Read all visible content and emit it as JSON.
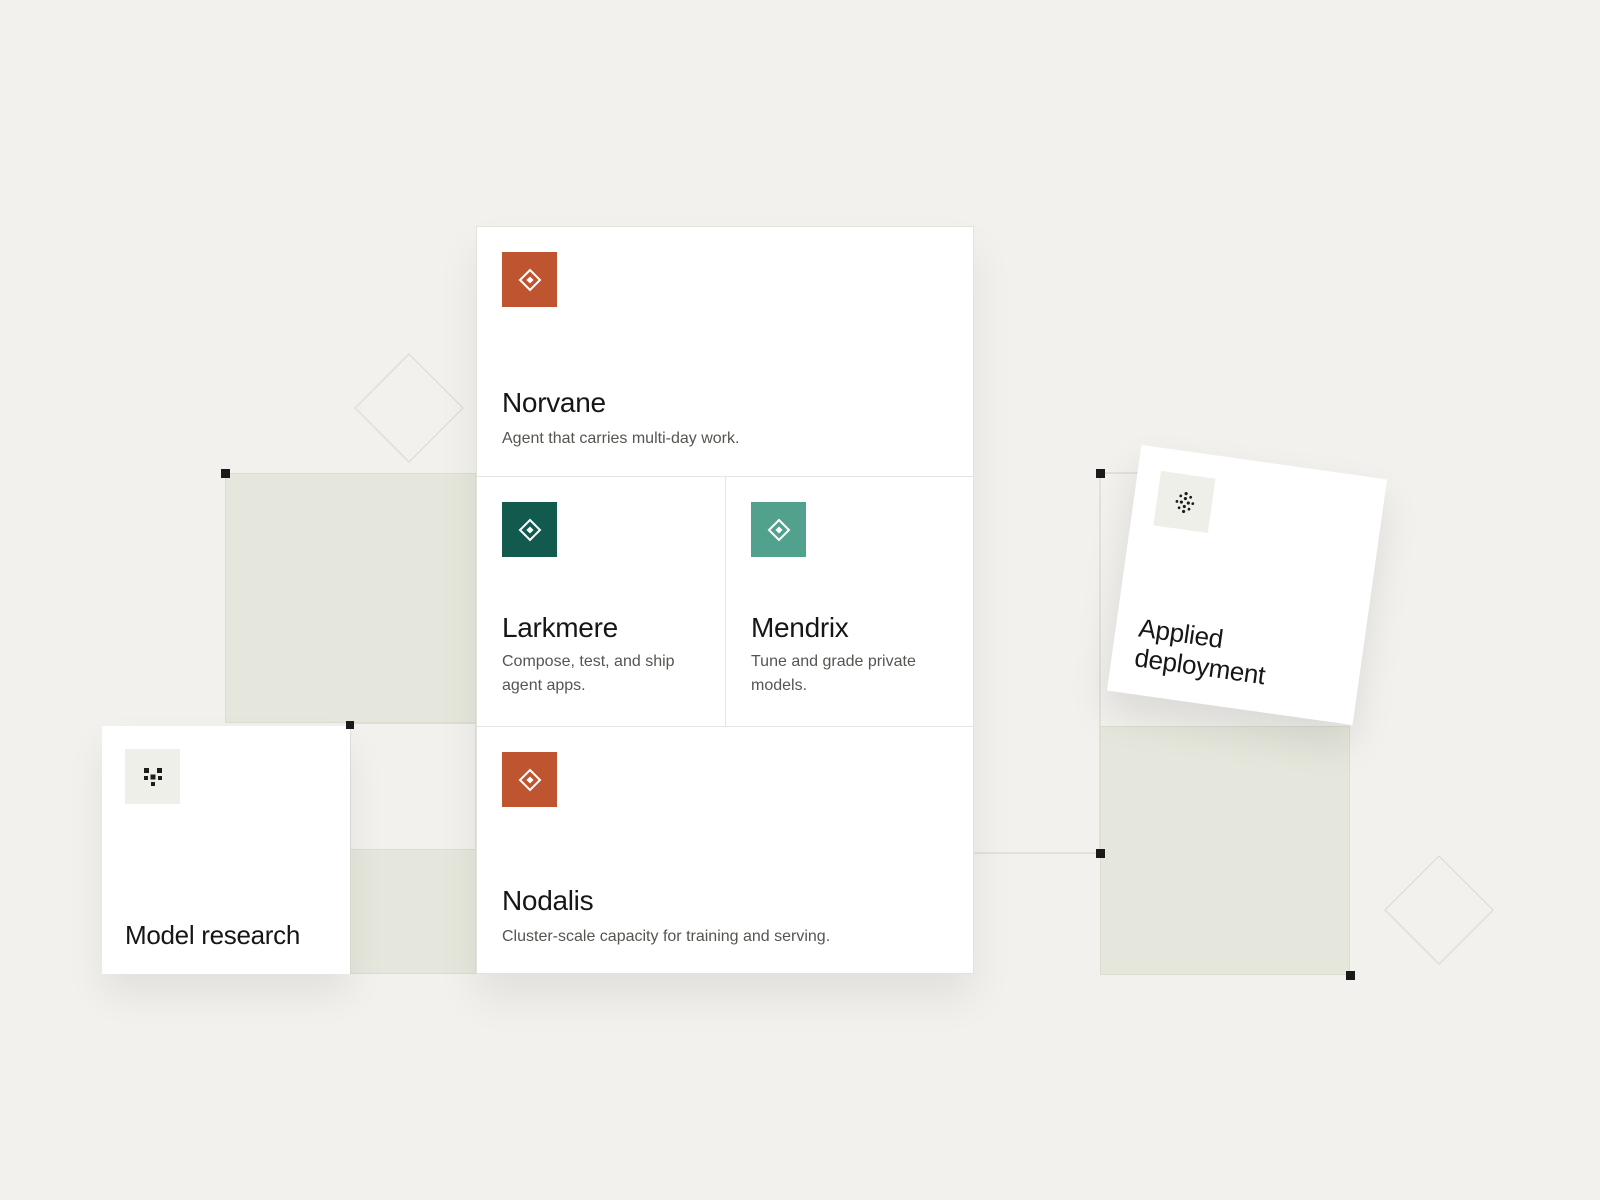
{
  "colors": {
    "background": "#f2f1ed",
    "accent_orange": "#bf5530",
    "accent_dark_green": "#135a4e",
    "accent_teal": "#52a08e",
    "block_green": "#e6e7dc"
  },
  "products": [
    {
      "name": "Norvane",
      "description": "Agent that carries multi-day work.",
      "icon": "diamond-icon",
      "color": "#bf5530"
    },
    {
      "name": "Larkmere",
      "description": "Compose, test, and ship agent apps.",
      "icon": "diamond-icon",
      "color": "#135a4e"
    },
    {
      "name": "Mendrix",
      "description": "Tune and grade private models.",
      "icon": "diamond-icon",
      "color": "#52a08e"
    },
    {
      "name": "Nodalis",
      "description": "Cluster-scale capacity for training and serving.",
      "icon": "diamond-icon",
      "color": "#bf5530"
    }
  ],
  "tiles": {
    "model_research": {
      "title": "Model research",
      "icon": "dot-grid-icon"
    },
    "applied_deployment": {
      "title": "Applied deployment",
      "icon": "dot-cluster-icon"
    }
  }
}
